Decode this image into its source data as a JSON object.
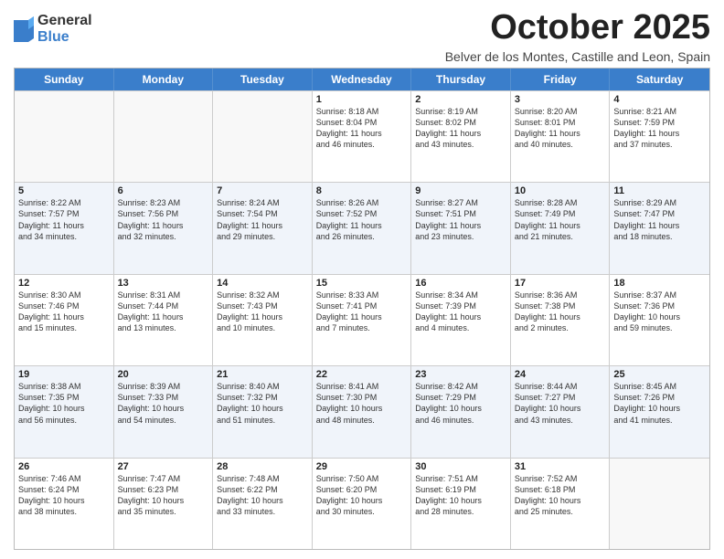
{
  "logo": {
    "general": "General",
    "blue": "Blue"
  },
  "title": "October 2025",
  "location": "Belver de los Montes, Castille and Leon, Spain",
  "header_days": [
    "Sunday",
    "Monday",
    "Tuesday",
    "Wednesday",
    "Thursday",
    "Friday",
    "Saturday"
  ],
  "weeks": [
    [
      {
        "day": "",
        "info": ""
      },
      {
        "day": "",
        "info": ""
      },
      {
        "day": "",
        "info": ""
      },
      {
        "day": "1",
        "info": "Sunrise: 8:18 AM\nSunset: 8:04 PM\nDaylight: 11 hours\nand 46 minutes."
      },
      {
        "day": "2",
        "info": "Sunrise: 8:19 AM\nSunset: 8:02 PM\nDaylight: 11 hours\nand 43 minutes."
      },
      {
        "day": "3",
        "info": "Sunrise: 8:20 AM\nSunset: 8:01 PM\nDaylight: 11 hours\nand 40 minutes."
      },
      {
        "day": "4",
        "info": "Sunrise: 8:21 AM\nSunset: 7:59 PM\nDaylight: 11 hours\nand 37 minutes."
      }
    ],
    [
      {
        "day": "5",
        "info": "Sunrise: 8:22 AM\nSunset: 7:57 PM\nDaylight: 11 hours\nand 34 minutes."
      },
      {
        "day": "6",
        "info": "Sunrise: 8:23 AM\nSunset: 7:56 PM\nDaylight: 11 hours\nand 32 minutes."
      },
      {
        "day": "7",
        "info": "Sunrise: 8:24 AM\nSunset: 7:54 PM\nDaylight: 11 hours\nand 29 minutes."
      },
      {
        "day": "8",
        "info": "Sunrise: 8:26 AM\nSunset: 7:52 PM\nDaylight: 11 hours\nand 26 minutes."
      },
      {
        "day": "9",
        "info": "Sunrise: 8:27 AM\nSunset: 7:51 PM\nDaylight: 11 hours\nand 23 minutes."
      },
      {
        "day": "10",
        "info": "Sunrise: 8:28 AM\nSunset: 7:49 PM\nDaylight: 11 hours\nand 21 minutes."
      },
      {
        "day": "11",
        "info": "Sunrise: 8:29 AM\nSunset: 7:47 PM\nDaylight: 11 hours\nand 18 minutes."
      }
    ],
    [
      {
        "day": "12",
        "info": "Sunrise: 8:30 AM\nSunset: 7:46 PM\nDaylight: 11 hours\nand 15 minutes."
      },
      {
        "day": "13",
        "info": "Sunrise: 8:31 AM\nSunset: 7:44 PM\nDaylight: 11 hours\nand 13 minutes."
      },
      {
        "day": "14",
        "info": "Sunrise: 8:32 AM\nSunset: 7:43 PM\nDaylight: 11 hours\nand 10 minutes."
      },
      {
        "day": "15",
        "info": "Sunrise: 8:33 AM\nSunset: 7:41 PM\nDaylight: 11 hours\nand 7 minutes."
      },
      {
        "day": "16",
        "info": "Sunrise: 8:34 AM\nSunset: 7:39 PM\nDaylight: 11 hours\nand 4 minutes."
      },
      {
        "day": "17",
        "info": "Sunrise: 8:36 AM\nSunset: 7:38 PM\nDaylight: 11 hours\nand 2 minutes."
      },
      {
        "day": "18",
        "info": "Sunrise: 8:37 AM\nSunset: 7:36 PM\nDaylight: 10 hours\nand 59 minutes."
      }
    ],
    [
      {
        "day": "19",
        "info": "Sunrise: 8:38 AM\nSunset: 7:35 PM\nDaylight: 10 hours\nand 56 minutes."
      },
      {
        "day": "20",
        "info": "Sunrise: 8:39 AM\nSunset: 7:33 PM\nDaylight: 10 hours\nand 54 minutes."
      },
      {
        "day": "21",
        "info": "Sunrise: 8:40 AM\nSunset: 7:32 PM\nDaylight: 10 hours\nand 51 minutes."
      },
      {
        "day": "22",
        "info": "Sunrise: 8:41 AM\nSunset: 7:30 PM\nDaylight: 10 hours\nand 48 minutes."
      },
      {
        "day": "23",
        "info": "Sunrise: 8:42 AM\nSunset: 7:29 PM\nDaylight: 10 hours\nand 46 minutes."
      },
      {
        "day": "24",
        "info": "Sunrise: 8:44 AM\nSunset: 7:27 PM\nDaylight: 10 hours\nand 43 minutes."
      },
      {
        "day": "25",
        "info": "Sunrise: 8:45 AM\nSunset: 7:26 PM\nDaylight: 10 hours\nand 41 minutes."
      }
    ],
    [
      {
        "day": "26",
        "info": "Sunrise: 7:46 AM\nSunset: 6:24 PM\nDaylight: 10 hours\nand 38 minutes."
      },
      {
        "day": "27",
        "info": "Sunrise: 7:47 AM\nSunset: 6:23 PM\nDaylight: 10 hours\nand 35 minutes."
      },
      {
        "day": "28",
        "info": "Sunrise: 7:48 AM\nSunset: 6:22 PM\nDaylight: 10 hours\nand 33 minutes."
      },
      {
        "day": "29",
        "info": "Sunrise: 7:50 AM\nSunset: 6:20 PM\nDaylight: 10 hours\nand 30 minutes."
      },
      {
        "day": "30",
        "info": "Sunrise: 7:51 AM\nSunset: 6:19 PM\nDaylight: 10 hours\nand 28 minutes."
      },
      {
        "day": "31",
        "info": "Sunrise: 7:52 AM\nSunset: 6:18 PM\nDaylight: 10 hours\nand 25 minutes."
      },
      {
        "day": "",
        "info": ""
      }
    ]
  ]
}
